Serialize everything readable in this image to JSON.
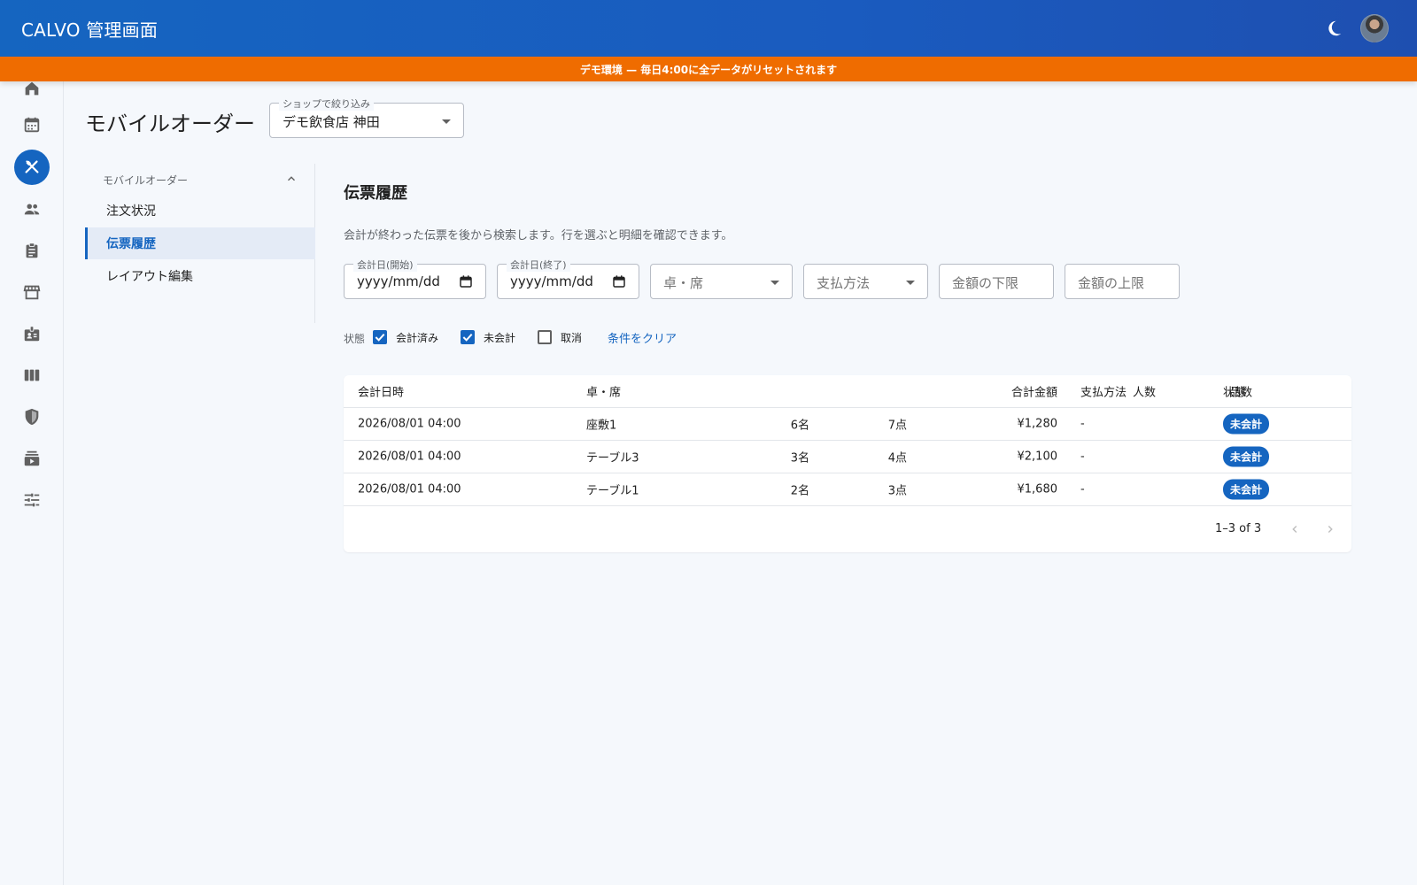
{
  "app": {
    "title": "CALVO 管理画面",
    "banner": "デモ環境 — 毎日4:00に全データがリセットされます"
  },
  "rail": {
    "items": [
      "home-icon",
      "calendar-icon",
      "restaurant-icon",
      "people-icon",
      "clipboard-icon",
      "store-icon",
      "badge-icon",
      "columns-icon",
      "shield-icon",
      "media-icon",
      "tune-icon"
    ],
    "active": "restaurant-icon"
  },
  "header": {
    "page_title": "モバイルオーダー",
    "shop_filter_label": "ショップで絞り込み",
    "shop_filter_value": "デモ飲食店 神田"
  },
  "subnav": {
    "group_label": "モバイルオーダー",
    "items": [
      "注文状況",
      "伝票履歴",
      "レイアウト編集"
    ],
    "active_index": 1
  },
  "main": {
    "title": "伝票履歴",
    "description": "会計が終わった伝票を後から検索します。行を選ぶと明細を確認できます。"
  },
  "filters": {
    "date_from_label": "会計日(開始)",
    "date_from_value": "yyyy/mm/dd",
    "date_to_label": "会計日(終了)",
    "date_to_value": "yyyy/mm/dd",
    "table_placeholder": "卓・席",
    "payment_placeholder": "支払方法",
    "amount_min_placeholder": "金額の下限",
    "amount_max_placeholder": "金額の上限"
  },
  "status_filter": {
    "label": "状態",
    "options": [
      {
        "label": "会計済み",
        "checked": true
      },
      {
        "label": "未会計",
        "checked": true
      },
      {
        "label": "取消",
        "checked": false
      }
    ],
    "clear_label": "条件をクリア"
  },
  "table": {
    "headers": [
      "会計日時",
      "卓・席",
      "人数",
      "品数",
      "合計金額",
      "支払方法",
      "状態"
    ],
    "rows": [
      [
        "2026/08/01 04:00",
        "座敷1",
        "6名",
        "7点",
        "¥1,280",
        "-",
        "未会計"
      ],
      [
        "2026/08/01 04:00",
        "テーブル3",
        "3名",
        "4点",
        "¥2,100",
        "-",
        "未会計"
      ],
      [
        "2026/08/01 04:00",
        "テーブル1",
        "2名",
        "3点",
        "¥1,680",
        "-",
        "未会計"
      ]
    ],
    "pagination": "1–3 of 3"
  },
  "colors": {
    "primary": "#1565c0",
    "banner": "#ef6c00",
    "background": "#f5f8fc"
  }
}
